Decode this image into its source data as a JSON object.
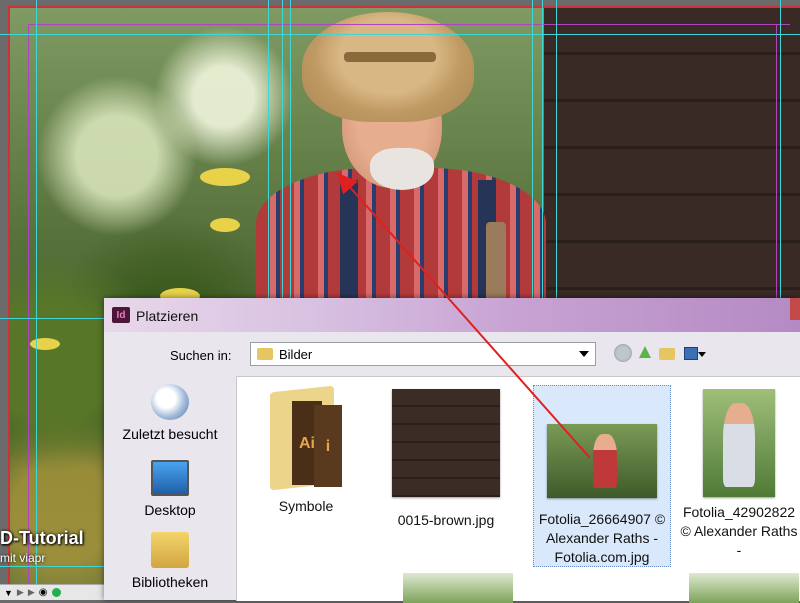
{
  "watermark": {
    "line1": "D-Tutorial",
    "line2": "mit  viapr"
  },
  "dialog": {
    "app_icon": "Id",
    "title": "Platzieren",
    "look_in_label": "Suchen in:",
    "look_in_value": "Bilder",
    "toolbar_icons": [
      "back-icon",
      "up-folder-icon",
      "new-folder-icon",
      "views-icon"
    ],
    "places": [
      {
        "label": "Zuletzt besucht",
        "icon": "recent-places-icon"
      },
      {
        "label": "Desktop",
        "icon": "desktop-icon"
      },
      {
        "label": "Bibliotheken",
        "icon": "libraries-icon"
      }
    ],
    "files": [
      {
        "name": "Symbole",
        "type": "folder"
      },
      {
        "name": "0015-brown.jpg",
        "type": "image"
      },
      {
        "name": "Fotolia_26664907 © Alexander Raths - Fotolia.com.jpg",
        "type": "image",
        "selected": true
      },
      {
        "name": "Fotolia_42902822 © Alexander Raths -",
        "type": "image"
      }
    ]
  },
  "colors": {
    "guide": "#3ed6d6",
    "margin": "#b044c0",
    "arrow": "#e02020",
    "selection": "#d9e8fa"
  }
}
